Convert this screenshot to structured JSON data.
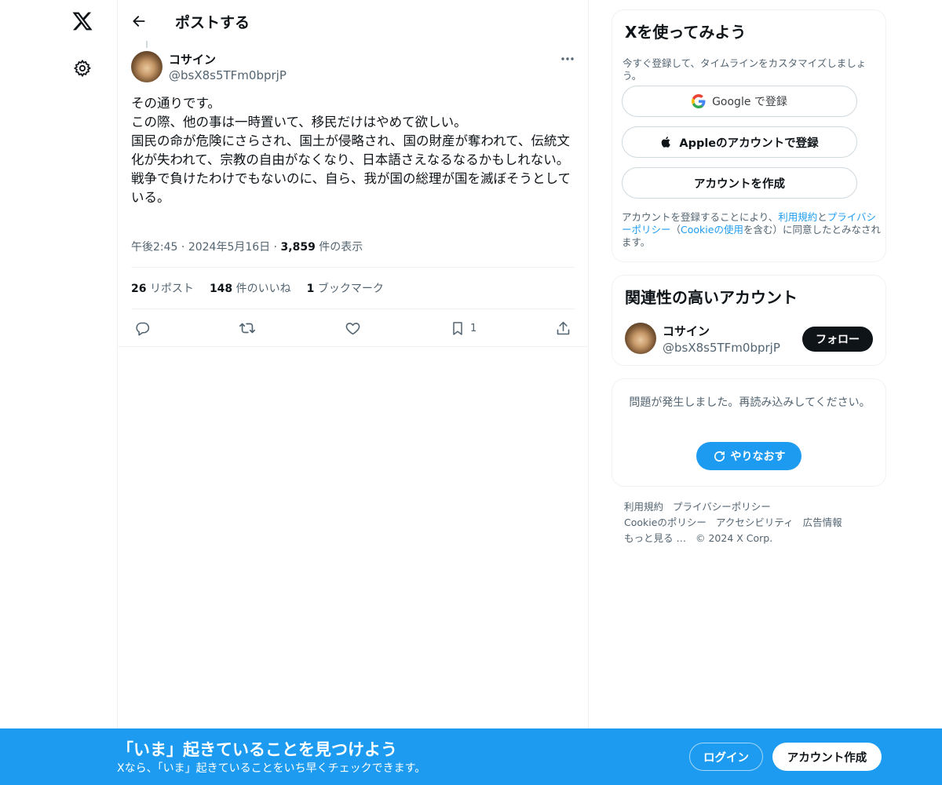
{
  "nav": {
    "logo_icon": "x-logo-icon",
    "settings_icon": "gear-icon"
  },
  "header": {
    "back_icon": "arrow-left-icon",
    "title": "ポストする"
  },
  "post": {
    "author_name": "コサイン",
    "author_handle": "@bsX8s5TFm0bprjP",
    "more_icon": "ellipsis-icon",
    "text": "その通りです。\nこの際、他の事は一時置いて、移民だけはやめて欲しい。\n国民の命が危険にさらされ、国土が侵略され、国の財産が奪われて、伝統文化が失われて、宗教の自由がなくなり、日本語さえなるなるかもしれない。\n戦争で負けたわけでもないのに、自ら、我が国の総理が国を滅ぼそうとしている。",
    "time": "午後2:45",
    "date": "2024年5月16日",
    "views_count": "3,859",
    "views_label": "件の表示",
    "separator": "·",
    "reposts_count": "26",
    "reposts_label": "リポスト",
    "likes_count": "148",
    "likes_label": "件のいいね",
    "bookmarks_count": "1",
    "bookmarks_label": "ブックマーク",
    "actions": {
      "reply_icon": "reply-icon",
      "repost_icon": "repost-icon",
      "like_icon": "heart-icon",
      "bookmark_icon": "bookmark-icon",
      "bookmark_count": "1",
      "share_icon": "share-icon"
    }
  },
  "signup_card": {
    "title": "Xを使ってみよう",
    "subtitle": "今すぐ登録して、タイムラインをカスタマイズしましょう。",
    "google_label": "Google で登録",
    "apple_label": "Appleのアカウントで登録",
    "create_label": "アカウントを作成",
    "terms_prefix": "アカウントを登録することにより、",
    "terms_link": "利用規約",
    "terms_and": "と",
    "privacy_link": "プライバシーポリシー",
    "paren_open": "（",
    "cookie_link": "Cookieの使用",
    "terms_suffix": "を含む）に同意したとみなされます。"
  },
  "related_card": {
    "title": "関連性の高いアカウント",
    "name": "コサイン",
    "handle": "@bsX8s5TFm0bprjP",
    "follow_label": "フォロー"
  },
  "error_card": {
    "message": "問題が発生しました。再読み込みしてください。",
    "retry_label": "やりなおす",
    "retry_icon": "refresh-icon"
  },
  "footer": {
    "links_row1": [
      "利用規約",
      "プライバシーポリシー"
    ],
    "links_row2": [
      "Cookieのポリシー",
      "アクセシビリティ",
      "広告情報"
    ],
    "more": "もっと見る …",
    "copyright": "© 2024 X Corp."
  },
  "banner": {
    "title": "「いま」起きていることを見つけよう",
    "subtitle": "Xなら、「いま」起きていることをいち早くチェックできます。",
    "login_label": "ログイン",
    "signup_label": "アカウント作成"
  },
  "colors": {
    "accent": "#1d9bf0",
    "text": "#0f1419",
    "muted": "#536471",
    "border": "#eff3f4"
  }
}
